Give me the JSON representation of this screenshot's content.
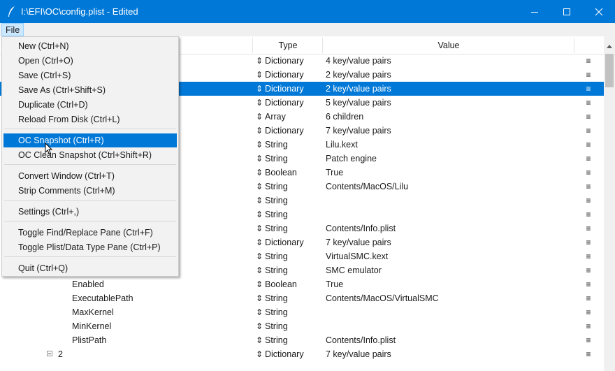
{
  "window": {
    "title": "I:\\EFI\\OC\\config.plist - Edited"
  },
  "menubar": {
    "file_label": "File"
  },
  "columns": {
    "type": "Type",
    "value": "Value"
  },
  "file_menu": [
    {
      "label": "New (Ctrl+N)"
    },
    {
      "label": "Open (Ctrl+O)"
    },
    {
      "label": "Save (Ctrl+S)"
    },
    {
      "label": "Save As (Ctrl+Shift+S)"
    },
    {
      "label": "Duplicate (Ctrl+D)"
    },
    {
      "label": "Reload From Disk (Ctrl+L)"
    },
    {
      "label": "OC Snapshot (Ctrl+R)",
      "highlighted": true
    },
    {
      "label": "OC Clean Snapshot (Ctrl+Shift+R)"
    },
    {
      "label": "Convert Window (Ctrl+T)"
    },
    {
      "label": "Strip Comments (Ctrl+M)"
    },
    {
      "label": "Settings (Ctrl+,)"
    },
    {
      "label": "Toggle Find/Replace Pane (Ctrl+F)"
    },
    {
      "label": "Toggle Plist/Data Type Pane (Ctrl+P)"
    },
    {
      "label": "Quit (Ctrl+Q)"
    }
  ],
  "rows": [
    {
      "key": "",
      "type": "Dictionary",
      "value": "4 key/value pairs"
    },
    {
      "key": "",
      "type": "Dictionary",
      "value": "2 key/value pairs"
    },
    {
      "key": "",
      "type": "Dictionary",
      "value": "2 key/value pairs",
      "selected": true
    },
    {
      "key": "",
      "type": "Dictionary",
      "value": "5 key/value pairs"
    },
    {
      "key": "",
      "type": "Array",
      "value": "6 children"
    },
    {
      "key": "",
      "type": "Dictionary",
      "value": "7 key/value pairs"
    },
    {
      "key": "",
      "type": "String",
      "value": "Lilu.kext"
    },
    {
      "key": "",
      "type": "String",
      "value": "Patch engine"
    },
    {
      "key": "",
      "type": "Boolean",
      "value": "True"
    },
    {
      "key": "",
      "type": "String",
      "value": "Contents/MacOS/Lilu"
    },
    {
      "key": "",
      "type": "String",
      "value": ""
    },
    {
      "key": "",
      "type": "String",
      "value": ""
    },
    {
      "key": "",
      "type": "String",
      "value": "Contents/Info.plist"
    },
    {
      "key": "",
      "type": "Dictionary",
      "value": "7 key/value pairs"
    },
    {
      "key": "",
      "type": "String",
      "value": "VirtualSMC.kext"
    },
    {
      "key": "",
      "type": "String",
      "value": "SMC emulator"
    },
    {
      "key": "Enabled",
      "type": "Boolean",
      "value": "True"
    },
    {
      "key": "ExecutablePath",
      "type": "String",
      "value": "Contents/MacOS/VirtualSMC"
    },
    {
      "key": "MaxKernel",
      "type": "String",
      "value": ""
    },
    {
      "key": "MinKernel",
      "type": "String",
      "value": ""
    },
    {
      "key": "PlistPath",
      "type": "String",
      "value": "Contents/Info.plist"
    },
    {
      "key": "2",
      "type": "Dictionary",
      "value": "7 key/value pairs",
      "expander": true
    }
  ],
  "glyphs": {
    "type_arrow": "⇕",
    "drag": "≡"
  },
  "colors": {
    "accent": "#0078d7",
    "menu_bg": "#f2f2f2"
  }
}
